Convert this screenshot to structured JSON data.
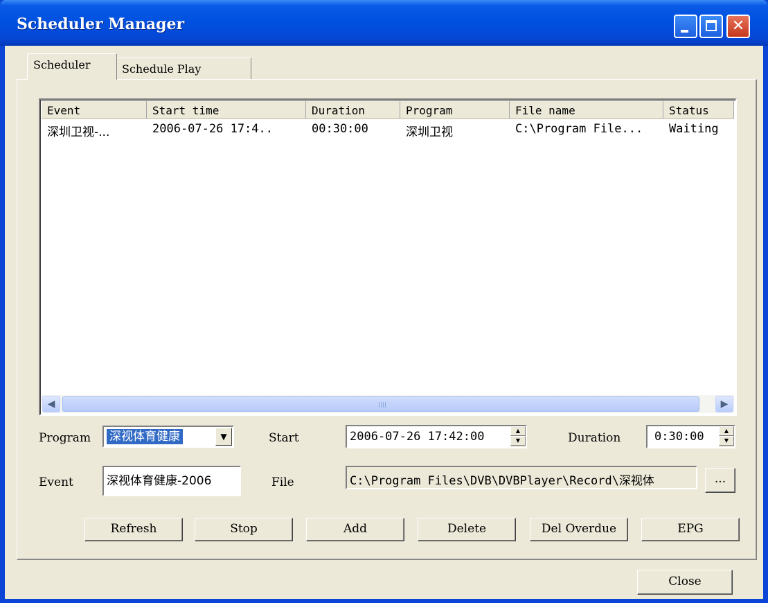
{
  "window": {
    "title": "Scheduler Manager"
  },
  "tabs": [
    {
      "label": "Scheduler",
      "active": true
    },
    {
      "label": "Schedule Play",
      "active": false
    }
  ],
  "table": {
    "columns": [
      "Event",
      "Start time",
      "Duration",
      "Program",
      "File name",
      "Status"
    ],
    "rows": [
      [
        "深圳卫视-...",
        "2006-07-26 17:4..",
        "00:30:00",
        "深圳卫视",
        "C:\\Program File...",
        "Waiting"
      ]
    ]
  },
  "form": {
    "program_label": "Program",
    "program_value": "深视体育健康",
    "start_label": "Start",
    "start_value": "2006-07-26 17:42:00",
    "duration_label": "Duration",
    "duration_value": "0:30:00",
    "event_label": "Event",
    "event_value": "深视体育健康-2006",
    "file_label": "File",
    "file_value": "C:\\Program Files\\DVB\\DVBPlayer\\Record\\深视体",
    "browse_label": "..."
  },
  "buttons": {
    "refresh": "Refresh",
    "stop": "Stop",
    "add": "Add",
    "delete": "Delete",
    "del_overdue": "Del Overdue",
    "epg": "EPG",
    "close": "Close"
  },
  "icons": {
    "minimize": "minimize-icon",
    "maximize": "maximize-icon",
    "close": "close-icon",
    "scroll_left": "arrow-left-icon",
    "scroll_right": "arrow-right-icon",
    "dropdown": "chevron-down-icon"
  },
  "colors": {
    "titlebar": "#0050e0",
    "face": "#ece9d8",
    "selection": "#316ac5",
    "close_button": "#c5381c"
  }
}
